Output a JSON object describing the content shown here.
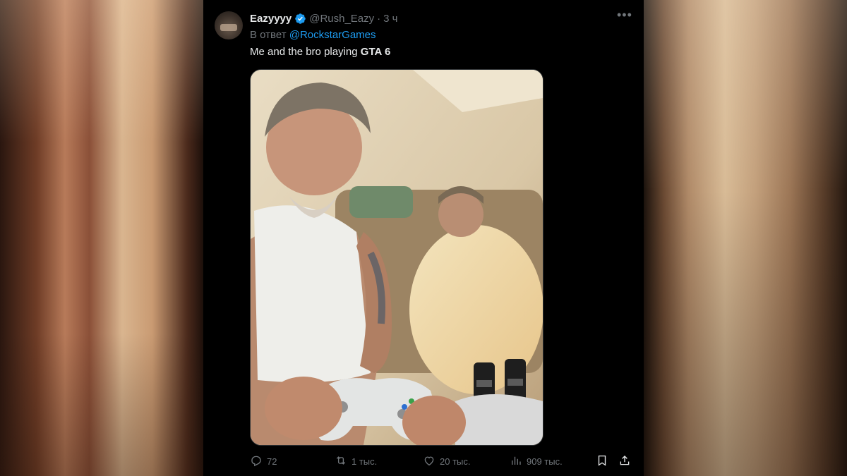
{
  "tweet": {
    "display_name": "Eazyyyy",
    "handle": "@Rush_Eazy",
    "separator": "·",
    "time": "3 ч",
    "reply_prefix": "В ответ",
    "reply_to": "@RockstarGames",
    "text_before": "Me and the bro playing ",
    "text_bold": "GTA 6",
    "media_icon": "photo",
    "more_icon": "more-horizontal-icon",
    "verified_color": "#1d9bf0"
  },
  "actions": {
    "replies": "72",
    "retweets": "1 тыс.",
    "likes": "20 тыс.",
    "views": "909 тыс."
  },
  "colors": {
    "background": "#000000",
    "text_primary": "#e7e9ea",
    "text_secondary": "#71767b",
    "link": "#1d9bf0"
  }
}
